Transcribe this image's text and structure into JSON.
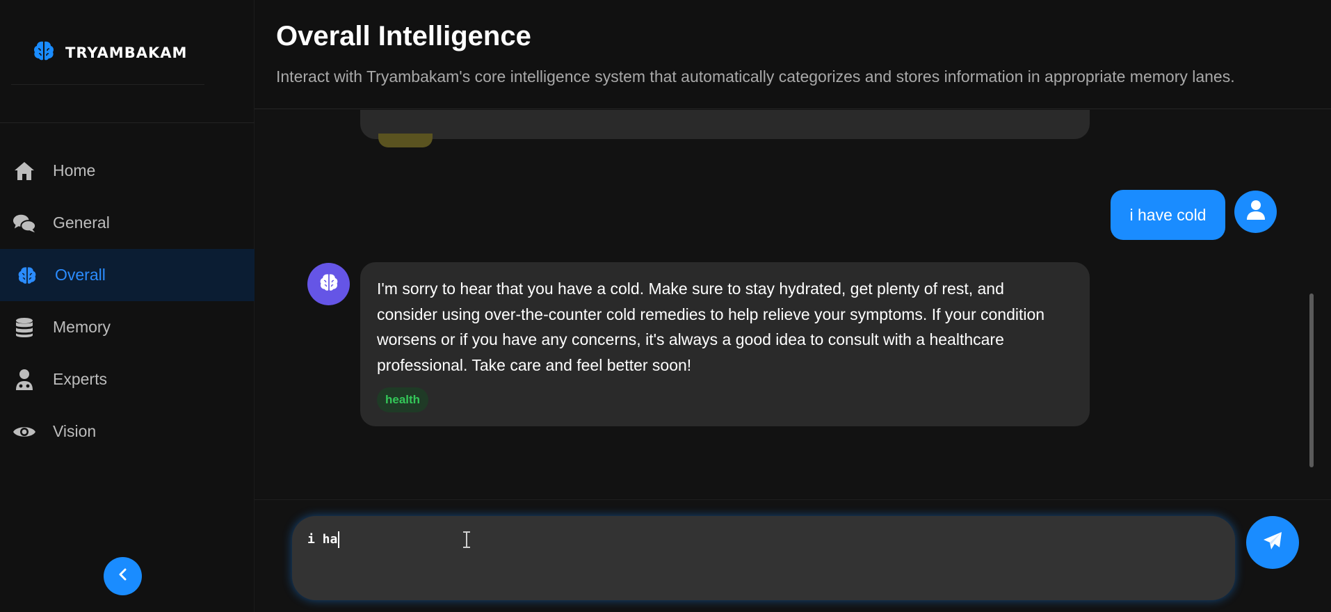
{
  "brand": {
    "name": "TRYAMBAKAM",
    "logo_icon": "brain-icon"
  },
  "sidebar": {
    "items": [
      {
        "label": "Home",
        "icon": "home-icon"
      },
      {
        "label": "General",
        "icon": "chat-bubbles-icon"
      },
      {
        "label": "Overall",
        "icon": "brain-icon",
        "active": true
      },
      {
        "label": "Memory",
        "icon": "database-icon"
      },
      {
        "label": "Experts",
        "icon": "doctor-icon"
      },
      {
        "label": "Vision",
        "icon": "eye-icon"
      }
    ],
    "collapse_icon": "chevron-left-icon"
  },
  "header": {
    "title": "Overall Intelligence",
    "subtitle": "Interact with Tryambakam's core intelligence system that automatically categorizes and stores information in appropriate memory lanes."
  },
  "chat": {
    "messages": [
      {
        "role": "user",
        "text": "i have cold",
        "avatar_icon": "user-icon"
      },
      {
        "role": "assistant",
        "avatar_icon": "brain-icon",
        "text": "I'm sorry to hear that you have a cold. Make sure to stay hydrated, get plenty of rest, and consider using over-the-counter cold remedies to help relieve your symptoms. If your condition worsens or if you have any concerns, it's always a good idea to consult with a healthcare professional. Take care and feel better soon!",
        "tag": "health"
      }
    ]
  },
  "composer": {
    "value": "i ha",
    "send_icon": "paper-plane-icon"
  },
  "colors": {
    "accent": "#1a8cff",
    "bot_avatar": "#6555e6",
    "tag_text": "#34c759",
    "tag_bg": "#1f3a26",
    "active_nav_bg": "#0b1d33"
  }
}
